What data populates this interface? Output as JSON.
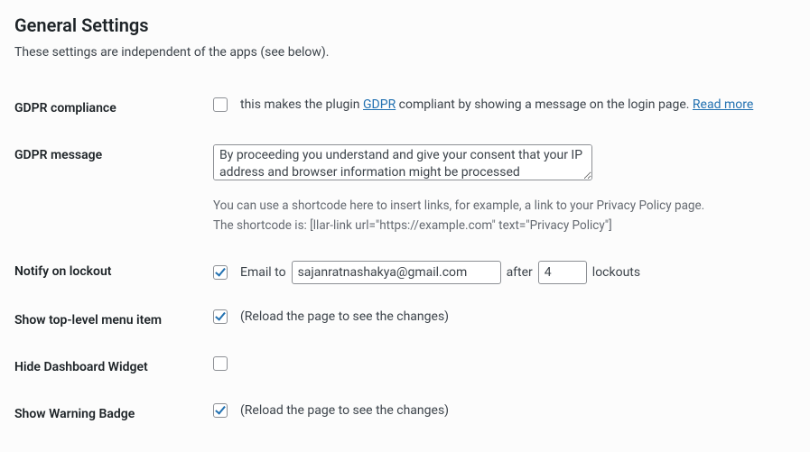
{
  "section": {
    "title": "General Settings",
    "description": "These settings are independent of the apps (see below)."
  },
  "rows": {
    "gdpr_compliance": {
      "label": "GDPR compliance",
      "checked": false,
      "text_before": "this makes the plugin ",
      "link1_text": "GDPR",
      "text_mid": " compliant by showing a message on the login page. ",
      "link2_text": "Read more"
    },
    "gdpr_message": {
      "label": "GDPR message",
      "value": "By proceeding you understand and give your consent that your IP address and browser information might be processed",
      "desc_line1": "You can use a shortcode here to insert links, for example, a link to your Privacy Policy page.",
      "desc_line2": "The shortcode is: [llar-link url=\"https://example.com\" text=\"Privacy Policy\"]"
    },
    "notify": {
      "label": "Notify on lockout",
      "checked": true,
      "text_email_to": "Email to",
      "email_value": "sajanratnashakya@gmail.com",
      "text_after": "after",
      "count_value": "4",
      "text_lockouts": "lockouts"
    },
    "show_menu": {
      "label": "Show top-level menu item",
      "checked": true,
      "note": "(Reload the page to see the changes)"
    },
    "hide_widget": {
      "label": "Hide Dashboard Widget",
      "checked": false
    },
    "show_badge": {
      "label": "Show Warning Badge",
      "checked": true,
      "note": "(Reload the page to see the changes)"
    }
  }
}
